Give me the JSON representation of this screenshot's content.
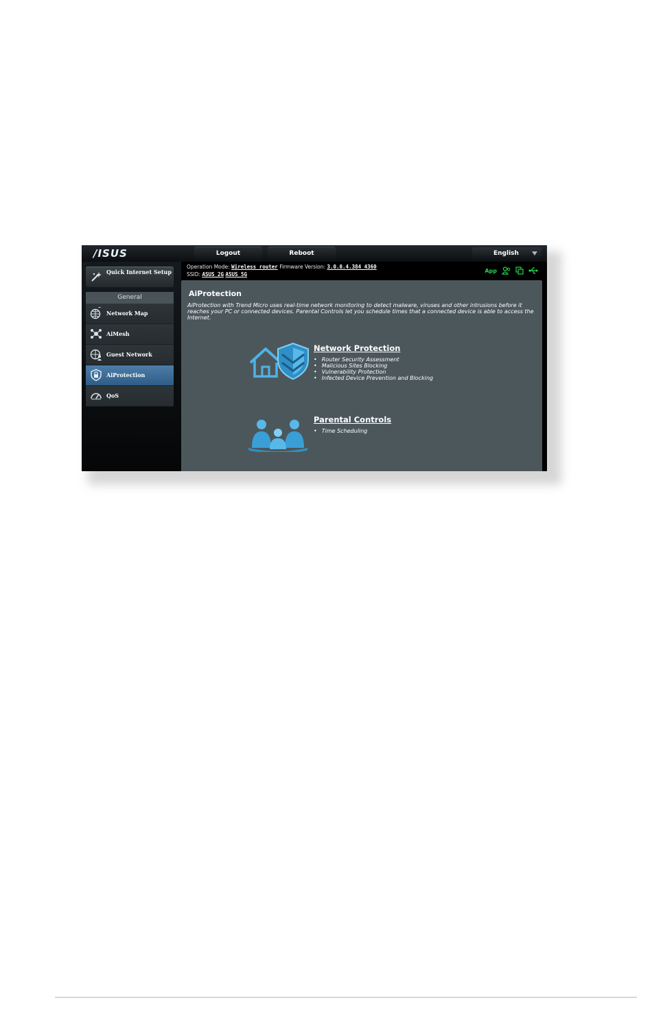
{
  "header": {
    "brand": "/ISUS",
    "logout_label": "Logout",
    "reboot_label": "Reboot",
    "language": "English"
  },
  "sidebar": {
    "quick_setup_label": "Quick Internet Setup",
    "general_header": "General",
    "items": [
      {
        "label": "Network Map",
        "icon": "network-map-icon",
        "active": false
      },
      {
        "label": "AiMesh",
        "icon": "aimesh-icon",
        "active": false
      },
      {
        "label": "Guest Network",
        "icon": "guest-network-icon",
        "active": false
      },
      {
        "label": "AiProtection",
        "icon": "aiprotection-icon",
        "active": true
      },
      {
        "label": "QoS",
        "icon": "qos-icon",
        "active": false
      }
    ]
  },
  "info": {
    "operation_mode_label": "Operation Mode:",
    "operation_mode_value": "Wireless router",
    "firmware_label": "Firmware Version:",
    "firmware_value": "3.0.0.4.384_4360",
    "ssid_label": "SSID:",
    "ssid_2g": "ASUS_2G",
    "ssid_5g": "ASUS_5G",
    "app_label": "App"
  },
  "content": {
    "title": "AiProtection",
    "description": "AiProtection with Trend Micro uses real-time network monitoring to detect malware, viruses and other intrusions before it reaches your PC or connected devices. Parental Controls let you schedule times that a connected device is able to access the Internet.",
    "network_protection": {
      "title": "Network Protection",
      "items": [
        "Router Security Assessment",
        "Malicious Sites Blocking",
        "Vulnerability Protection",
        "Infected Device Prevention and Blocking"
      ]
    },
    "parental_controls": {
      "title": "Parental Controls",
      "items": [
        "Time Scheduling"
      ]
    }
  },
  "colors": {
    "accent_blue": "#3a8fc6",
    "active_menu": "#3d6f9a",
    "status_green": "#22d84a",
    "content_bg": "#4c575c"
  }
}
